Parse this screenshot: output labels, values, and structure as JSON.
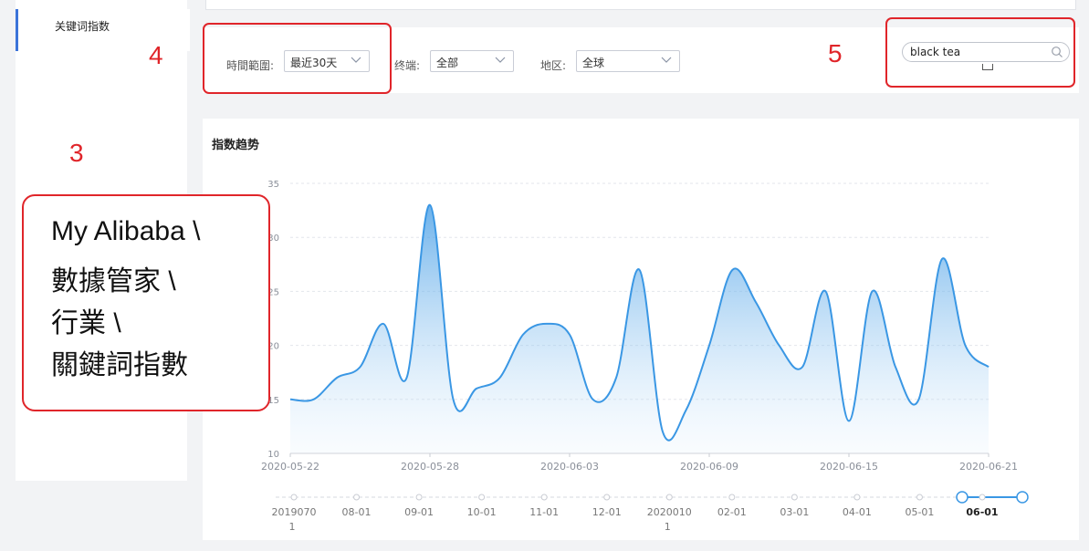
{
  "sidebar": {
    "items": [
      {
        "label": "关键词指数",
        "active": true
      }
    ]
  },
  "filters": {
    "time_range": {
      "label": "時間範圍:",
      "value": "最近30天"
    },
    "terminal": {
      "label": "终端:",
      "value": "全部"
    },
    "region": {
      "label": "地区:",
      "value": "全球"
    }
  },
  "search": {
    "value": "black tea"
  },
  "annotations": {
    "marker_3": "3",
    "marker_4": "4",
    "marker_5": "5",
    "note_lines": [
      "My Alibaba \\",
      "數據管家 \\",
      "行業 \\",
      "關鍵詞指數"
    ]
  },
  "chart_title": "指数趋势",
  "colors": {
    "accent": "#3a97e4",
    "annotation": "#e0252a",
    "sidebar_active": "#3b73d9"
  },
  "chart_data": {
    "type": "area",
    "title": "指数趋势",
    "ylim": [
      10,
      35
    ],
    "yticks": [
      10,
      15,
      20,
      25,
      30,
      35
    ],
    "x_ticks": [
      "2020-05-22",
      "2020-05-28",
      "2020-06-03",
      "2020-06-09",
      "2020-06-15",
      "2020-06-21"
    ],
    "x": [
      "2020-05-22",
      "2020-05-23",
      "2020-05-24",
      "2020-05-25",
      "2020-05-26",
      "2020-05-27",
      "2020-05-28",
      "2020-05-29",
      "2020-05-30",
      "2020-05-31",
      "2020-06-01",
      "2020-06-02",
      "2020-06-03",
      "2020-06-04",
      "2020-06-05",
      "2020-06-06",
      "2020-06-07",
      "2020-06-08",
      "2020-06-09",
      "2020-06-10",
      "2020-06-11",
      "2020-06-12",
      "2020-06-13",
      "2020-06-14",
      "2020-06-15",
      "2020-06-16",
      "2020-06-17",
      "2020-06-18",
      "2020-06-19",
      "2020-06-20",
      "2020-06-21"
    ],
    "values": [
      15,
      15,
      17,
      18,
      22,
      17,
      33,
      15,
      16,
      17,
      21,
      22,
      21,
      15,
      17,
      27,
      12,
      14,
      20,
      27,
      24,
      20,
      18,
      25,
      13,
      25,
      18,
      15,
      28,
      20,
      18
    ],
    "grid": true,
    "timeline": {
      "labels": [
        "2019070\n1",
        "08-01",
        "09-01",
        "10-01",
        "11-01",
        "12-01",
        "2020010\n1",
        "02-01",
        "03-01",
        "04-01",
        "05-01",
        "06-01"
      ],
      "selected": "06-01"
    }
  }
}
